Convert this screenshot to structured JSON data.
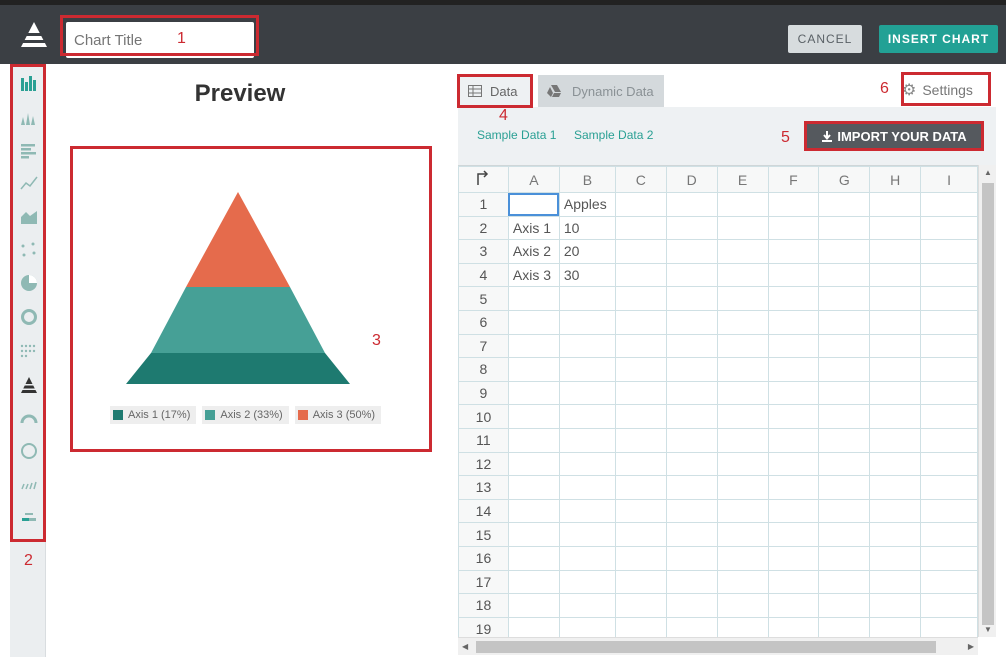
{
  "header": {
    "chart_title_placeholder": "Chart Title",
    "cancel_label": "CANCEL",
    "insert_label": "INSERT CHART"
  },
  "preview": {
    "title": "Preview",
    "legend": [
      {
        "label": "Axis 1 (17%)",
        "color": "#1e7a70"
      },
      {
        "label": "Axis 2 (33%)",
        "color": "#46a096"
      },
      {
        "label": "Axis 3 (50%)",
        "color": "#e56b4c"
      }
    ]
  },
  "chart_data": {
    "type": "pyramid",
    "categories": [
      "Axis 1",
      "Axis 2",
      "Axis 3"
    ],
    "series": [
      {
        "name": "Apples",
        "values": [
          10,
          20,
          30
        ]
      }
    ],
    "percentages": [
      "17%",
      "33%",
      "50%"
    ]
  },
  "tabs": {
    "data": "Data",
    "dynamic": "Dynamic Data",
    "settings": "Settings"
  },
  "samples": [
    "Sample Data 1",
    "Sample Data 2"
  ],
  "import_label": "IMPORT YOUR DATA",
  "spreadsheet": {
    "columns": [
      "A",
      "B",
      "C",
      "D",
      "E",
      "F",
      "G",
      "H",
      "I"
    ],
    "rows": [
      [
        "",
        "Apples"
      ],
      [
        "Axis 1",
        "10"
      ],
      [
        "Axis 2",
        "20"
      ],
      [
        "Axis 3",
        "30"
      ]
    ],
    "row_count": 19
  },
  "annotations": [
    "1",
    "2",
    "3",
    "4",
    "5",
    "6"
  ],
  "colors": {
    "topbar": "#3b3f44",
    "accent": "#22a195",
    "annotation": "#cc2a31",
    "pyramid_bottom": "#1e7a70",
    "pyramid_middle": "#46a096",
    "pyramid_top": "#e56b4c"
  }
}
